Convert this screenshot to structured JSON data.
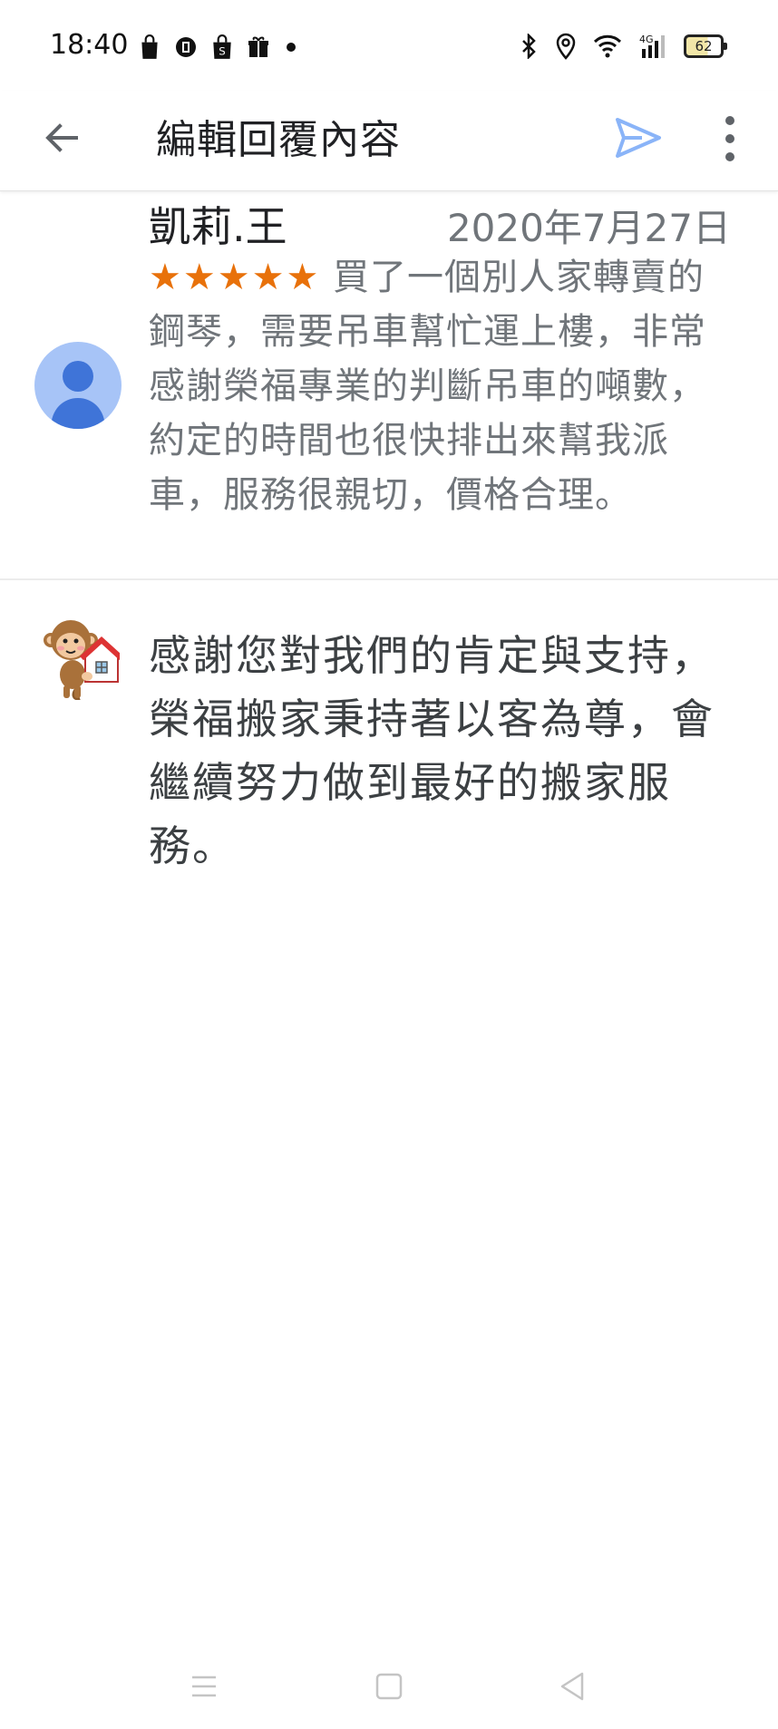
{
  "status_bar": {
    "time": "18:40",
    "network": "4G",
    "battery": "62",
    "icons_left": [
      "shopping-bag-icon",
      "app-icon",
      "shopee-icon",
      "gift-icon",
      "dot-icon"
    ],
    "icons_right": [
      "bluetooth-icon",
      "location-icon",
      "wifi-icon",
      "signal-icon",
      "battery-icon"
    ]
  },
  "app_bar": {
    "title": "編輯回覆內容",
    "actions": [
      "back-icon",
      "send-icon",
      "more-vert-icon"
    ],
    "send_color": "#8ab4f8"
  },
  "review": {
    "reviewer_name": "凱莉.王",
    "date": "2020年7月27日",
    "stars": "★★★★★",
    "rating": 5,
    "text": "買了一個別人家轉賣的鋼琴，需要吊車幫忙運上樓，非常感謝榮福專業的判斷吊車的噸數，約定的時間也很快排出來幫我派車，服務很親切，價格合理。",
    "star_color": "#e8710a"
  },
  "reply": {
    "text": "感謝您對我們的肯定與支持，榮福搬家秉持著以客為尊，會繼續努力做到最好的搬家服務。"
  },
  "nav_bar": {
    "buttons": [
      "menu-icon",
      "home-icon",
      "back-triangle-icon"
    ]
  }
}
